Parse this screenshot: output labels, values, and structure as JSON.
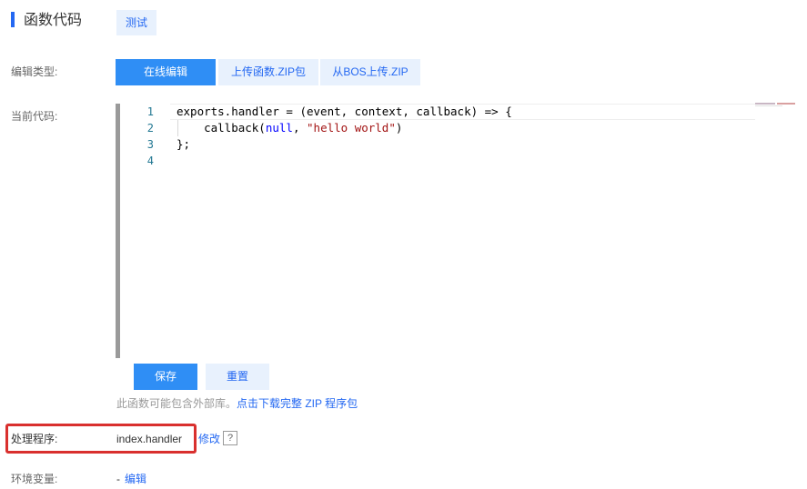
{
  "header": {
    "title": "函数代码",
    "test_label": "测试"
  },
  "edit_type": {
    "label": "编辑类型:",
    "tabs": [
      {
        "label": "在线编辑",
        "active": true
      },
      {
        "label": "上传函数.ZIP包",
        "active": false
      },
      {
        "label": "从BOS上传.ZIP",
        "active": false
      }
    ]
  },
  "current_code": {
    "label": "当前代码:",
    "line_numbers": [
      "1",
      "2",
      "3",
      "4"
    ],
    "lines": [
      "exports.handler = (event, context, callback) => {",
      "    callback(null, \"hello world\")",
      "};",
      ""
    ],
    "code_parts": {
      "line2_prefix": "    callback(",
      "line2_null": "null",
      "line2_sep": ", ",
      "line2_str": "\"hello world\"",
      "line2_suffix": ")"
    }
  },
  "actions": {
    "save_label": "保存",
    "reset_label": "重置"
  },
  "notice": {
    "text": "此函数可能包含外部库。",
    "link": "点击下载完整 ZIP 程序包"
  },
  "handler": {
    "label": "处理程序:",
    "value": "index.handler",
    "modify_label": "修改",
    "help_label": "?"
  },
  "env": {
    "label": "环境变量:",
    "value": "-",
    "edit_label": "编辑"
  },
  "colors": {
    "accent": "#2468f2",
    "primary_button": "#2f8ef5",
    "light_button": "#e8f1fd",
    "highlight_border": "#d9302e",
    "keyword": "#0000ff",
    "string": "#a31515",
    "line_number": "#237893"
  }
}
